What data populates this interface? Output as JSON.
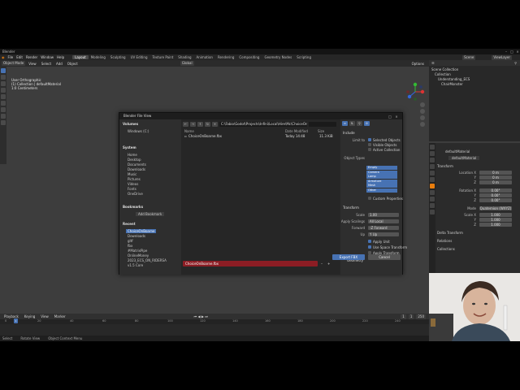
{
  "window": {
    "title": "Blender"
  },
  "menubar": {
    "menus": [
      "File",
      "Edit",
      "Render",
      "Window",
      "Help"
    ],
    "workspaces": [
      "Layout",
      "Modeling",
      "Sculpting",
      "UV Editing",
      "Texture Paint",
      "Shading",
      "Animation",
      "Rendering",
      "Compositing",
      "Geometry Nodes",
      "Scripting"
    ],
    "active_workspace": "Layout",
    "scene": "Scene",
    "view_layer": "ViewLayer"
  },
  "viewport_header": {
    "mode": "Object Mode",
    "menus": [
      "View",
      "Select",
      "Add",
      "Object"
    ],
    "orientation": "Global",
    "options": "Options"
  },
  "viewport_info": {
    "line1": "User Orthographic",
    "line2": "(1) Collection | defaultMaterial",
    "line3": "1:0 Centimeters"
  },
  "outliner": {
    "root": "Scene Collection",
    "items": [
      "Collection",
      "Understanding_ECS",
      "ChairMonster"
    ]
  },
  "properties": {
    "object_name": "defaultMaterial",
    "data_name": "defaultMaterial",
    "sections": {
      "transform": "Transform",
      "delta": "Delta Transform",
      "relations": "Relations",
      "collections": "Collections"
    },
    "location_label": "Location X",
    "y_label": "Y",
    "z_label": "Z",
    "location": [
      "0 m",
      "0 m",
      "0 m"
    ],
    "rotation_label": "Rotation X",
    "rotation": [
      "0.00°",
      "0.00°",
      "0.00°"
    ],
    "mode_label": "Mode",
    "mode": "Quaternion (WXYZ)",
    "scale_label": "Scale X",
    "scale": [
      "1.000",
      "1.000",
      "1.000"
    ]
  },
  "timeline": {
    "menus": [
      "Playback",
      "Keying",
      "View",
      "Marker"
    ],
    "current_frame": "1",
    "start": "1",
    "end": "250",
    "ticks": [
      "0",
      "20",
      "40",
      "60",
      "80",
      "100",
      "120",
      "140",
      "160",
      "180",
      "200",
      "220",
      "240"
    ]
  },
  "statusbar": {
    "items": [
      "Select",
      "Rotate View",
      "Object Context Menu"
    ]
  },
  "file_dialog": {
    "title": "Blender File View",
    "sections": {
      "volumes": "Volumes",
      "system": "System",
      "bookmarks": "Bookmarks",
      "recent": "Recent"
    },
    "volumes": [
      "Windows (C:)"
    ],
    "system": [
      "Home",
      "Desktop",
      "Documents",
      "Downloads",
      "Music",
      "Pictures",
      "Videos",
      "Fonts",
      "OneDrive"
    ],
    "add_bookmark": "Add Bookmark",
    "recent": [
      "ChoiceOnBoarne",
      "Downloads",
      "gltf",
      "fbx",
      "#MatrixPipe",
      "OnlineMoney",
      "2023_ECS_ON_RIDERSA",
      "v1.5 Core"
    ],
    "path": "C:\\Fabio\\Godot\\Projects\\Infini\\Local\\Hire\\Mc\\ChoiceOnBoarne\\",
    "search_placeholder": "",
    "columns": {
      "name": "Name",
      "date": "Date Modified",
      "size": "Size"
    },
    "files": [
      {
        "name": "ChoiceOnBoarne.fbx",
        "date": "Today 14:48",
        "size": "11.3 KiB"
      }
    ],
    "filename": "ChoiceOnBoarne.fbx",
    "export_label": "Export FBX",
    "cancel_label": "Cancel",
    "options": {
      "include_label": "Include",
      "limit_to_label": "Limit to",
      "selected_objects": "Selected Objects",
      "visible_objects": "Visible Objects",
      "active_collection": "Active Collection",
      "object_types_label": "Object Types",
      "object_types": [
        "Empty",
        "Camera",
        "Lamp",
        "Armature",
        "Mesh",
        "Other"
      ],
      "custom_properties": "Custom Properties",
      "transform_label": "Transform",
      "scale_label": "Scale",
      "scale": "1.00",
      "apply_scalings_label": "Apply Scalings",
      "apply_scalings": "All Local",
      "forward_label": "Forward",
      "forward": "-Z Forward",
      "up_label": "Up",
      "up": "Y Up",
      "apply_unit": "Apply Unit",
      "use_space_transform": "Use Space Transform",
      "apply_transform": "Apply Transform",
      "geometry_label": "Geometry"
    }
  }
}
